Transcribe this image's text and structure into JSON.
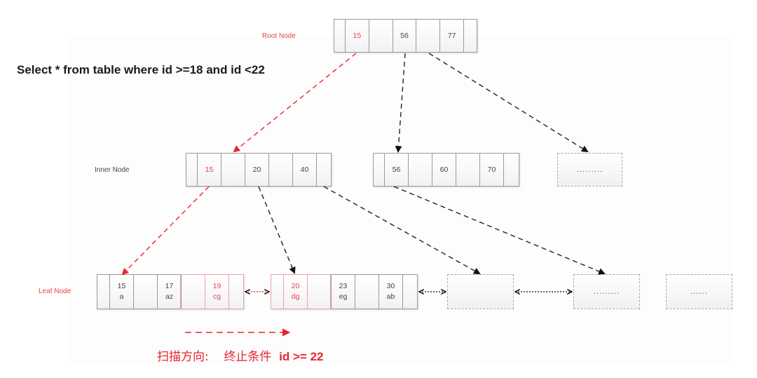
{
  "query": "Select * from table where id >=18 and  id <22",
  "labels": {
    "root": "Root  Node",
    "inner": "Inner Node",
    "leaf": "Leaf Node"
  },
  "colors": {
    "highlight": "#e8434b",
    "normal": "#444444",
    "border": "#9a9a9a"
  },
  "root_node": {
    "keys": [
      "15",
      "56",
      "77"
    ],
    "highlight_index": 0
  },
  "inner_nodes": [
    {
      "keys": [
        "15",
        "20",
        "40"
      ],
      "highlight_index": 0
    },
    {
      "keys": [
        "56",
        "60",
        "70"
      ]
    },
    {
      "placeholder": "........."
    }
  ],
  "leaf_nodes": [
    {
      "entries": [
        {
          "key": "15",
          "val": "a"
        },
        {
          "key": "17",
          "val": "az"
        },
        {
          "key": "19",
          "val": "cg",
          "highlight": true
        }
      ]
    },
    {
      "entries": [
        {
          "key": "20",
          "val": "dg",
          "highlight": true
        },
        {
          "key": "23",
          "val": "eg"
        },
        {
          "key": "30",
          "val": "ab"
        }
      ]
    },
    {
      "placeholder": ""
    },
    {
      "placeholder": "........."
    },
    {
      "placeholder": "......"
    }
  ],
  "footer": {
    "scan_direction": "扫描方向:",
    "stop_condition": "终止条件",
    "condition": "id >= 22"
  }
}
